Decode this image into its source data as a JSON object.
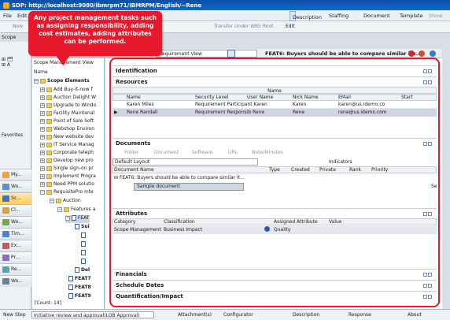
{
  "window": {
    "title": "SDP: http://localhost:9080/ibmrpm71/IBMRPM/English/~Rene"
  },
  "menu": [
    "File",
    "Edit"
  ],
  "tabs_top": [
    "Description",
    "Staffing",
    "Document",
    "Template",
    "Show"
  ],
  "toolbar": {
    "new_label": "New",
    "transfer_label": "Transfer Under WBS Root",
    "edit_label": "Edit",
    "view_select": "Requirement View"
  },
  "record_title": "FEAT6: Buyers should be able to compare similar ite...",
  "left": {
    "scope_label": "Scope",
    "nav_items": [
      "My...",
      "Wo...",
      "Sc...",
      "Cl...",
      "Wo...",
      "Tim...",
      "Ex...",
      "Pr...",
      "Re...",
      "Wo..."
    ],
    "favorites": "Favorites"
  },
  "tree": {
    "view_label": "Scope Management View",
    "col_name": "Name",
    "root": "Scope Elements",
    "items": [
      "Add Buy-it-now f",
      "Auction Delight W",
      "Upgrade to Windo",
      "Facility Maintenal",
      "Point of Sale Soft",
      "Webshop Environ",
      "New website dev",
      "IT Service Manag",
      "Corporate teleph",
      "Develop new pro",
      "Single sign-on pr",
      "Implement Progra",
      "Need PPM solutio",
      "RequisitePro Inte"
    ],
    "sub": [
      "Auction",
      "Features a",
      "FEAT",
      "Sui",
      "Del",
      "FEAT7",
      "FEAT8",
      "FEAT9"
    ],
    "count": "[Count: 14]"
  },
  "callout": "Any project management tasks such as assigning responsibility, adding  cost estimates, adding attributes can be performed.",
  "sections": {
    "identification": "Identification",
    "resources": "Resources",
    "documents": "Documents",
    "attributes": "Attributes",
    "financials": "Financials",
    "schedule": "Schedule Dates",
    "quant": "Quantification/Impact"
  },
  "resources": {
    "group_header": "Name",
    "headers": [
      "Name",
      "Security Level",
      "User Name",
      "Nick Name",
      "EMail",
      "Start"
    ],
    "rows": [
      [
        "Karen Miles",
        "Requirement Participant Karen",
        "Karen",
        "karen@us.idemo.co"
      ],
      [
        "Rene Randall",
        "Requirement Responsib Rene",
        "Rene",
        "rene@us.idemo.com"
      ]
    ]
  },
  "documents": {
    "tools": [
      "Folder",
      "Document",
      "Software",
      "URL",
      "Note/Minutes"
    ],
    "layout": "Default Layout",
    "indicators": "Indicators",
    "col_doc": "Document Name",
    "filters": [
      "Type",
      "Created",
      "Private",
      "Rank",
      "Priority"
    ],
    "feat_row": "FEAT6: Buyers should be able to compare similar it...",
    "sample": "Sample document",
    "cut": "Se"
  },
  "attributes": {
    "headers": [
      "Category",
      "Classification",
      "Assigned Attribute",
      "Value"
    ],
    "row": [
      "Scope Management",
      "Business Impact",
      "Quality"
    ]
  },
  "status": {
    "next_step": "New Step",
    "workflow": "Initiative review and approval(LOB Approval)",
    "attachments": "Attachment(s)",
    "configurator": "Configurator",
    "desc": "Description",
    "response": "Response",
    "about": "About"
  },
  "colors": {
    "callout": "#e8192c",
    "titlebar": "#0a4fa5"
  }
}
